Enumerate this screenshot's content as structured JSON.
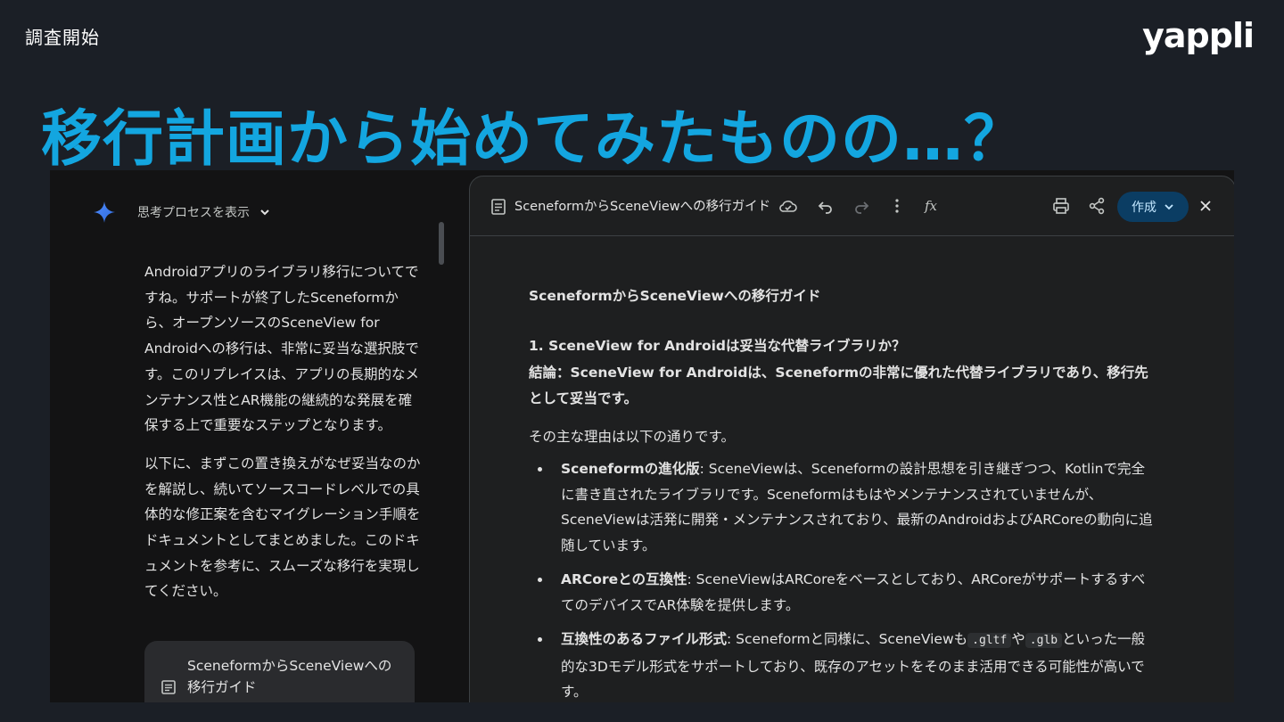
{
  "slide": {
    "section_label": "調査開始",
    "brand": "yappli",
    "title": "移行計画から始めてみたものの…？"
  },
  "chat": {
    "think_label": "思考プロセスを表示",
    "paragraphs": [
      "Androidアプリのライブラリ移行についてですね。サポートが終了したSceneformから、オープンソースのSceneView for Androidへの移行は、非常に妥当な選択肢です。このリプレイスは、アプリの長期的なメンテナンス性とAR機能の継続的な発展を確保する上で重要なステップとなります。",
      "以下に、まずこの置き換えがなぜ妥当なのかを解説し、続いてソースコードレベルでの具体的な修正案を含むマイグレーション手順をドキュメントとしてまとめました。このドキュメントを参考に、スムーズな移行を実現してください。"
    ],
    "doc_card_title": "SceneformからSceneViewへの移行ガイド"
  },
  "doc": {
    "toolbar_title": "SceneformからSceneViewへの移行ガイド",
    "create_label": "作成",
    "heading": "SceneformからSceneViewへの移行ガイド",
    "section1_heading": "1. SceneView for Androidは妥当な代替ライブラリか？",
    "conclusion": "結論：SceneView for Androidは、Sceneformの非常に優れた代替ライブラリであり、移行先として妥当です。",
    "intro": "その主な理由は以下の通りです。",
    "bullets": [
      {
        "term": "Sceneformの進化版",
        "text": ": SceneViewは、Sceneformの設計思想を引き継ぎつつ、Kotlinで完全に書き直されたライブラリです。Sceneformはもはやメンテナンスされていませんが、SceneViewは活発に開発・メンテナンスされており、最新のAndroidおよびARCoreの動向に追随しています。"
      },
      {
        "term": "ARCoreとの互換性",
        "text": ": SceneViewはARCoreをベースとしており、ARCoreがサポートするすべてのデバイスでAR体験を提供します。"
      },
      {
        "term": "互換性のあるファイル形式",
        "text_a": ": Sceneformと同様に、SceneViewも",
        "code_a": ".gltf",
        "text_b": "や",
        "code_b": ".glb",
        "text_c": "といった一般的な3Dモデル形式をサポートしており、既存のアセットをそのまま活用できる可能性が高いです。"
      }
    ]
  },
  "colors": {
    "title_accent": "#13a6e0",
    "background": "#1b1f26",
    "create_button": "#0b3d63"
  }
}
